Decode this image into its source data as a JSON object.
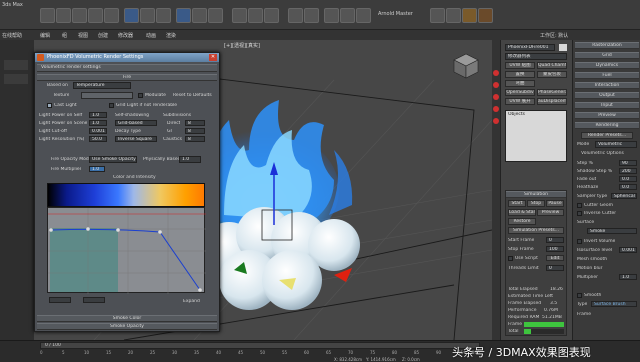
{
  "app": {
    "title": "3ds Max",
    "menu_left": "在线帮助",
    "menu_items": [
      "编辑",
      "组",
      "视图",
      "创建",
      "修改器",
      "动画",
      "渲染"
    ],
    "top_hint": "Arnold Master",
    "workspace_label": "工作区: 默认"
  },
  "viewport": {
    "label": "[+][透视][真实]"
  },
  "dialog": {
    "title": "PhoenixFD Volumetric Render Settings",
    "subtitle": "Volumetric render settings",
    "fire_section": "Fire",
    "based_on_label": "Based on",
    "based_on_value": "Temperature",
    "texture_label": "Texture",
    "modulate_label": "Modulate",
    "reset_button": "Reset to Defaults",
    "cast_light_label": "Cast Light",
    "grid_light_label": "Grid Light if not renderable",
    "light_power_self_label": "Light Power on Self",
    "light_power_self_value": "1.0",
    "light_power_scene_label": "Light Power on Scene",
    "light_power_scene_value": "1.0",
    "light_cutoff_label": "Light Cut-off",
    "light_cutoff_value": "0.001",
    "light_res_label": "Light Resolution (%)",
    "light_res_value": "50.0",
    "self_shadowing_label": "Self-shadowing",
    "self_shadowing_value": "Grid-based",
    "decay_type_label": "Decay Type",
    "decay_type_value": "Inverse Square",
    "subdivisions_label": "Subdivisions",
    "direct_label": "Direct",
    "direct_value": "8",
    "gi_label": "GI",
    "gi_value": "8",
    "caustics_label": "Caustics",
    "caustics_value": "8",
    "fire_opacity_label": "Fire Opacity Mode",
    "fire_opacity_value": "Use Smoke Opacity",
    "phys_based_label": "Physically Based",
    "phys_based_value": "1.0",
    "fire_multiplier_label": "Fire Multiplier",
    "fire_multiplier_value": "1.0",
    "color_intensity_label": "Color and Intensity",
    "expand_label": "Expand",
    "smoke_color_label": "Smoke Color",
    "smoke_opacity_label": "Smoke Opacity"
  },
  "right_panel": {
    "object_name": "PhoenixFDFire001",
    "modifier_list": "修改器列表",
    "quad_chamfer": "Quad Chamfer",
    "open_subdiv": "OpenSubdiv",
    "phase_generator": "PhaseGenerator",
    "uvw_map": "UVW 贴图",
    "displace": "置换",
    "skin_wrap": "蒙皮包裹",
    "bend": "弯曲",
    "replace_label": "UVW 展开",
    "unwrap_label": "auDisplacement",
    "objects_label": "Objects",
    "simulation": "Simulation",
    "start_btn": "Start",
    "stop_btn": "Stop",
    "pause_btn": "Pause",
    "load_start": "Load & Start",
    "preview": "Preview",
    "restore": "Restore",
    "sim_presets": "Simulation Presets...",
    "start_frame_label": "Start Frame",
    "start_frame_value": "0",
    "stop_frame_label": "Stop Frame",
    "stop_frame_value": "100",
    "use_script": "Use Script",
    "use_script_value": "Edit",
    "threads_label": "Threads Limit",
    "threads_value": "0",
    "total_elapsed": "Total Elapsed",
    "total_elapsed_value": "18.26",
    "est_time": "Estimated Time Left",
    "frame_elapsed": "Frame Elapsed",
    "frame_elapsed_value": "3.5",
    "performance": "Performance",
    "performance_value": "0.76M",
    "required_ram": "Required RAM",
    "required_ram_value": "51.21MB",
    "frame_label": "Frame",
    "total_label": "Total"
  },
  "far_right": {
    "items": [
      "Rasterization",
      "Grid",
      "Dynamics",
      "Fuel",
      "Interaction",
      "Output",
      "Input",
      "Preview",
      "Rendering",
      "Render Presets..."
    ],
    "mode_label": "Mode",
    "mode_value": "Volumetric",
    "volumetric_options": "Volumetric Options",
    "step_label": "Step %",
    "step_value": "90",
    "shadow_step_label": "Shadow Step %",
    "shadow_step_value": "200",
    "fade_out_label": "Fade out",
    "fade_out_value": "0.0",
    "heathaze_label": "Heathaze",
    "heathaze_value": "0.0",
    "sampler_label": "Sampler type",
    "sampler_value": "Spherical",
    "cutter_geom": "Cutter Geom",
    "inverse_cutter": "Inverse Cutter",
    "surface_label": "Surface",
    "surface_value": "Smoke",
    "invert_volume": "Invert Volume",
    "isosurface_label": "Isosurface level",
    "isosurface_value": "0.001",
    "mesh_smooth": "Mesh smooth",
    "motion_blur": "Motion blur",
    "multiplier_label": "Multiplier",
    "multiplier_value": "1.0",
    "smooth_label": "Smooth",
    "type_label": "Type",
    "type_value": "Surface Brush",
    "frame_label": "Frame"
  },
  "status": {
    "frame_counter": "0 / 100",
    "ticks": [
      "0",
      "5",
      "10",
      "15",
      "20",
      "25",
      "30",
      "35",
      "40",
      "45",
      "50",
      "55",
      "60",
      "65",
      "70",
      "75",
      "80",
      "85",
      "90",
      "95",
      "100"
    ],
    "coord_x": "X: 832.428cm",
    "coord_y": "Y: 1414.916cm",
    "coord_z": "Z: 0.0cm",
    "watermark": "头条号 / 3DMAX效果图表现"
  }
}
